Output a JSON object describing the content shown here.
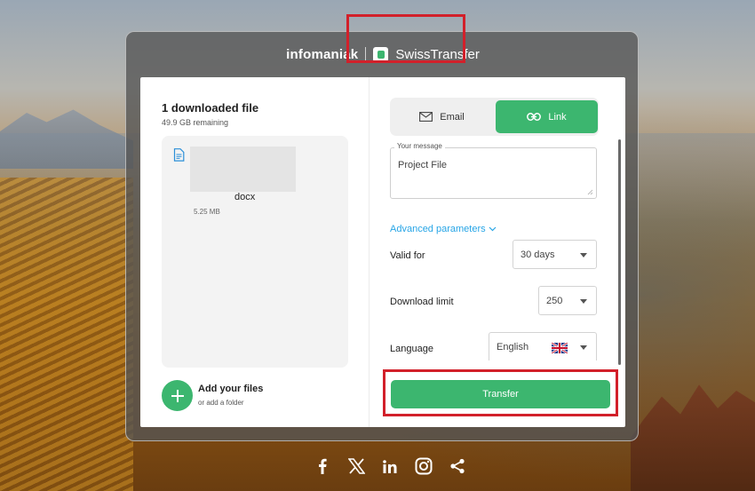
{
  "brand": {
    "infomaniak": "infomaniak",
    "product": "SwissTransfer"
  },
  "files": {
    "title": "1 downloaded file",
    "remaining": "49.9 GB remaining",
    "items": [
      {
        "name": "docx",
        "size": "5.25 MB",
        "icon": "document-icon"
      }
    ],
    "add_title": "Add your files",
    "add_subtitle": "or add a folder"
  },
  "mode_tabs": [
    {
      "label": "Email",
      "icon": "envelope-icon",
      "selected": false
    },
    {
      "label": "Link",
      "icon": "link-icon",
      "selected": true
    }
  ],
  "message": {
    "label": "Your message",
    "value": "Project File"
  },
  "advanced": {
    "label": "Advanced parameters",
    "icon": "chevron-down-icon"
  },
  "settings": {
    "valid_for": {
      "label": "Valid for",
      "value": "30 days"
    },
    "download_limit": {
      "label": "Download limit",
      "value": "250"
    },
    "language": {
      "label": "Language",
      "value": "English",
      "flag": "uk-flag-icon"
    }
  },
  "transfer_label": "Transfer",
  "social": [
    "facebook-icon",
    "x-icon",
    "linkedin-icon",
    "instagram-icon",
    "share-icon"
  ],
  "colors": {
    "accent": "#3cb66f",
    "link": "#27a5e6",
    "highlight": "#d2202a"
  }
}
